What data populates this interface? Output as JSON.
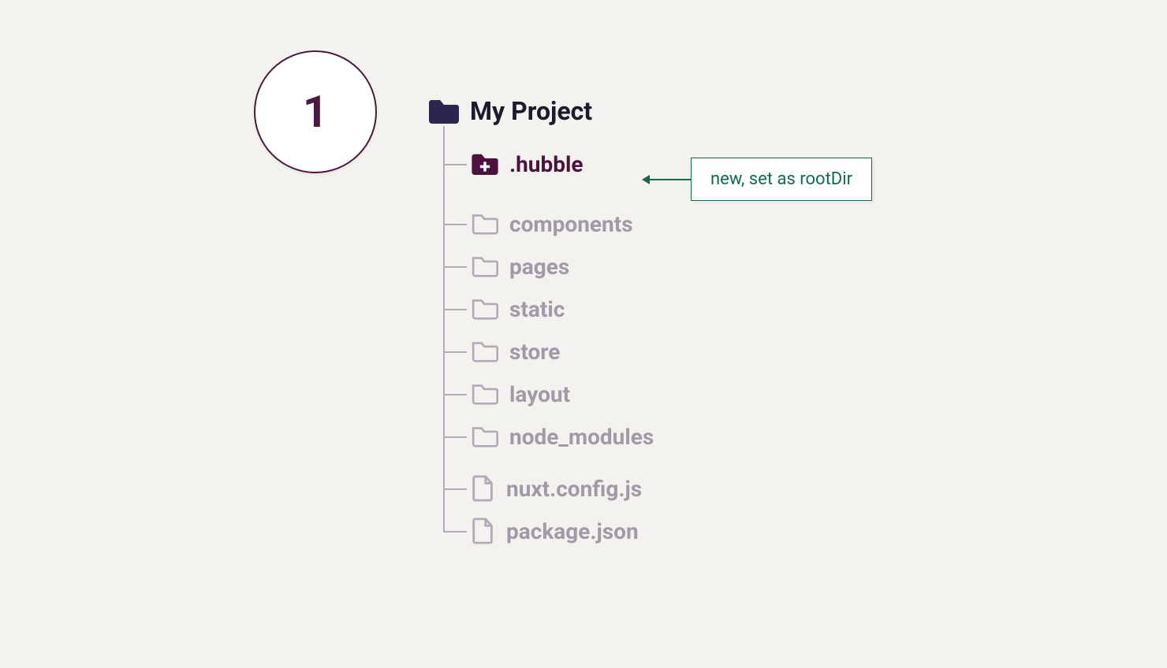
{
  "step": "1",
  "root_label": "My Project",
  "annotation": {
    "text": "new, set as rootDir"
  },
  "tree": {
    "hubble_label": ".hubble",
    "folders": {
      "components": "components",
      "pages": "pages",
      "static": "static",
      "store": "store",
      "layout": "layout",
      "node_modules": "node_modules"
    },
    "files": {
      "nuxt_config": "nuxt.config.js",
      "package_json": "package.json"
    }
  }
}
